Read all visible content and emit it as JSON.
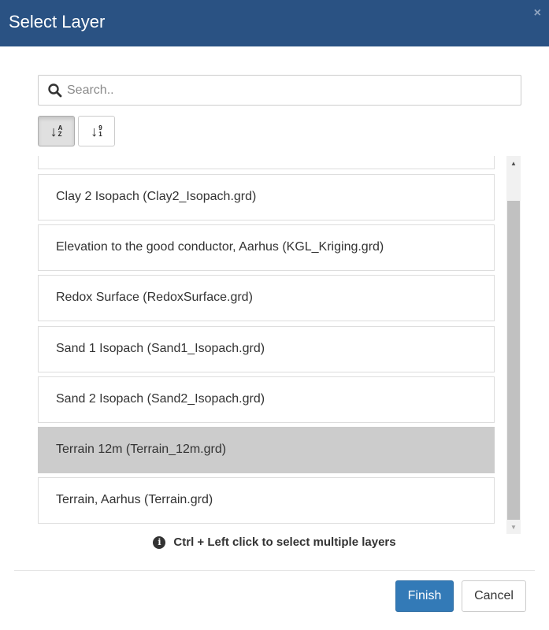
{
  "header": {
    "title": "Select Layer",
    "close_symbol": "×",
    "close_icon": "close-icon"
  },
  "search": {
    "placeholder": "Search..",
    "value": "",
    "icon": "search-icon"
  },
  "sort": {
    "alpha": {
      "icon": "sort-alpha-icon",
      "top": "A",
      "bottom": "Z",
      "active": true
    },
    "numeric": {
      "icon": "sort-numeric-icon",
      "top": "9",
      "bottom": "1",
      "active": false
    }
  },
  "layers": {
    "items": [
      {
        "label": "",
        "selected": false
      },
      {
        "label": "Clay 2 Isopach (Clay2_Isopach.grd)",
        "selected": false
      },
      {
        "label": "Elevation to the good conductor, Aarhus (KGL_Kriging.grd)",
        "selected": false
      },
      {
        "label": "Redox Surface (RedoxSurface.grd)",
        "selected": false
      },
      {
        "label": "Sand 1 Isopach (Sand1_Isopach.grd)",
        "selected": false
      },
      {
        "label": "Sand 2 Isopach (Sand2_Isopach.grd)",
        "selected": false
      },
      {
        "label": "Terrain 12m (Terrain_12m.grd)",
        "selected": true
      },
      {
        "label": "Terrain, Aarhus (Terrain.grd)",
        "selected": false
      }
    ],
    "selected_background": "#cccccc"
  },
  "hint": {
    "icon": "info-icon",
    "symbol": "i",
    "text": "Ctrl + Left click to select multiple layers"
  },
  "footer": {
    "finish_label": "Finish",
    "cancel_label": "Cancel"
  },
  "colors": {
    "header_bg": "#2a5283",
    "primary": "#337ab7"
  }
}
